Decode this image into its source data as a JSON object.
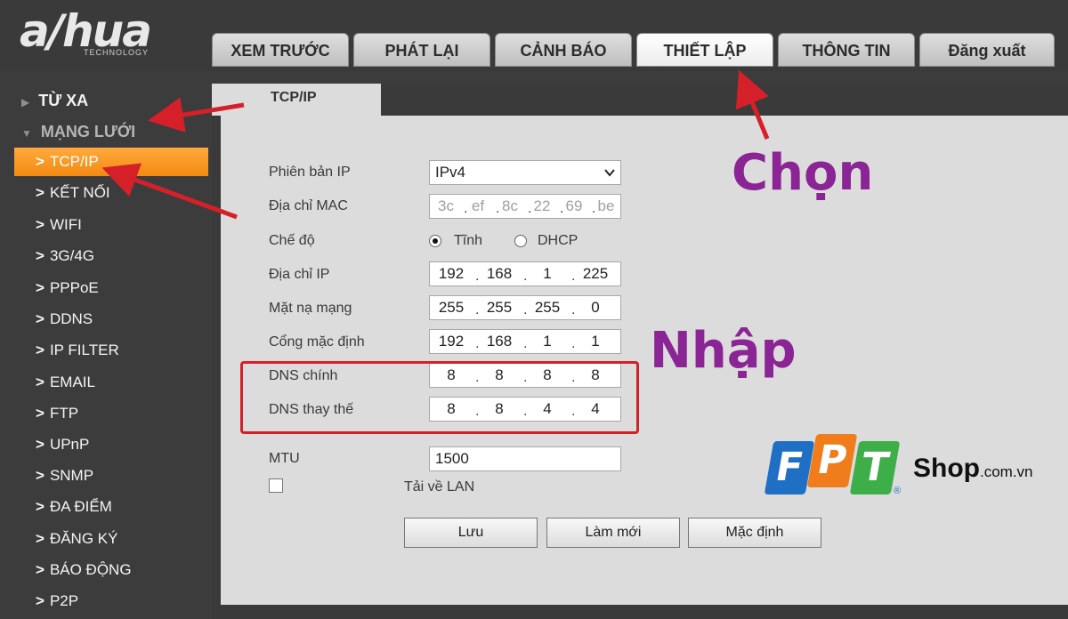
{
  "logo": {
    "brand": "a/hua",
    "sub": "TECHNOLOGY"
  },
  "nav": {
    "tabs": [
      "XEM TRƯỚC",
      "PHÁT LẠI",
      "CẢNH BÁO",
      "THIẾT LẬP",
      "THÔNG TIN",
      "Đăng xuất"
    ],
    "active": "THIẾT LẬP"
  },
  "sidebar": {
    "section_remote": "TỪ XA",
    "section_network": "MẠNG LƯỚI",
    "items": [
      "TCP/IP",
      "KẾT NỐI",
      "WIFI",
      "3G/4G",
      "PPPoE",
      "DDNS",
      "IP FILTER",
      "EMAIL",
      "FTP",
      "UPnP",
      "SNMP",
      "ĐA ĐIỂM",
      "ĐĂNG KÝ",
      "BÁO ĐỘNG",
      "P2P"
    ],
    "active": "TCP/IP"
  },
  "content": {
    "tab_title": "TCP/IP",
    "labels": {
      "ip_version": "Phiên bản IP",
      "mac": "Địa chỉ MAC",
      "mode": "Chế độ",
      "ip": "Địa chỉ IP",
      "subnet": "Mặt nạ mạng",
      "gateway": "Cổng mặc định",
      "dns1": "DNS chính",
      "dns2": "DNS thay thế",
      "mtu": "MTU",
      "download_lan": "Tải về LAN"
    },
    "ip_version_value": "IPv4",
    "mac": [
      "3c",
      "ef",
      "8c",
      "22",
      "69",
      "be"
    ],
    "mode_static": "Tĩnh",
    "mode_dhcp": "DHCP",
    "mode_selected": "static",
    "ip": [
      "192",
      "168",
      "1",
      "225"
    ],
    "subnet": [
      "255",
      "255",
      "255",
      "0"
    ],
    "gateway": [
      "192",
      "168",
      "1",
      "1"
    ],
    "dns1": [
      "8",
      "8",
      "8",
      "8"
    ],
    "dns2": [
      "8",
      "8",
      "4",
      "4"
    ],
    "mtu": "1500",
    "buttons": {
      "save": "Lưu",
      "refresh": "Làm mới",
      "default": "Mặc định"
    }
  },
  "annotations": {
    "chon": "Chọn",
    "nhap": "Nhập"
  },
  "watermark": {
    "brand": "FPT",
    "letters": [
      "F",
      "P",
      "T"
    ],
    "shop": "Shop",
    "domain": ".com.vn",
    "reg": "®"
  },
  "colors": {
    "accent": "#f38a12",
    "highlight": "#d5202a",
    "annotation": "#8b2494",
    "fpt_blue": "#1f6fc5",
    "fpt_orange": "#f07c1b",
    "fpt_green": "#3eae49"
  }
}
